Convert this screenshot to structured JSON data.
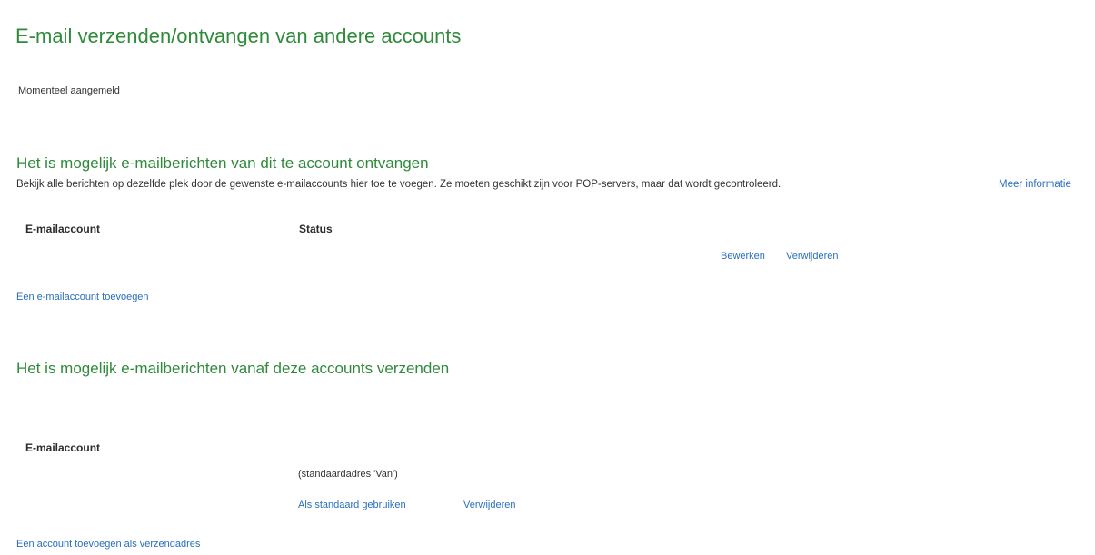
{
  "page": {
    "title": "E-mail verzenden/ontvangen van andere accounts",
    "signed_in_label": "Momenteel aangemeld"
  },
  "receive": {
    "title": "Het is mogelijk e-mailberichten van dit te account ontvangen",
    "description": "Bekijk alle berichten op dezelfde plek door de gewenste e-mailaccounts hier toe te voegen. Ze moeten geschikt zijn voor POP-servers, maar dat wordt gecontroleerd.",
    "more_info_link": "Meer informatie",
    "columns": {
      "account": "E-mailaccount",
      "status": "Status"
    },
    "row_actions": {
      "edit": "Bewerken",
      "remove": "Verwijderen"
    },
    "add_link": "Een e-mailaccount toevoegen"
  },
  "send": {
    "title": "Het is mogelijk e-mailberichten vanaf deze accounts verzenden",
    "columns": {
      "account": "E-mailaccount"
    },
    "default_note": "(standaardadres 'Van')",
    "row_actions": {
      "set_default": "Als standaard gebruiken",
      "remove": "Verwijderen"
    },
    "add_link": "Een account toevoegen als verzendadres"
  },
  "colors": {
    "heading_green": "#2f8a3a",
    "link_blue": "#2a6ebb",
    "text": "#333333"
  }
}
